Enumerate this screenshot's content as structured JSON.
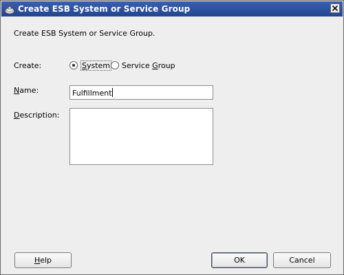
{
  "window": {
    "title": "Create ESB System or Service Group"
  },
  "intro_text": "Create ESB System or Service Group.",
  "create": {
    "label": "Create:",
    "options": [
      {
        "pre": "",
        "mnemonic": "S",
        "post": "ystem",
        "selected": true
      },
      {
        "pre": "Service ",
        "mnemonic": "G",
        "post": "roup",
        "selected": false
      }
    ]
  },
  "name": {
    "label_mnemonic": "N",
    "label_rest": "ame:",
    "value": "Fulfillment"
  },
  "description": {
    "label_mnemonic": "D",
    "label_rest": "escription:",
    "value": ""
  },
  "buttons": {
    "help_mnemonic": "H",
    "help_rest": "elp",
    "ok": "OK",
    "cancel": "Cancel"
  },
  "icons": {
    "app": "oracle-jdeveloper-icon",
    "close": "close-icon"
  }
}
